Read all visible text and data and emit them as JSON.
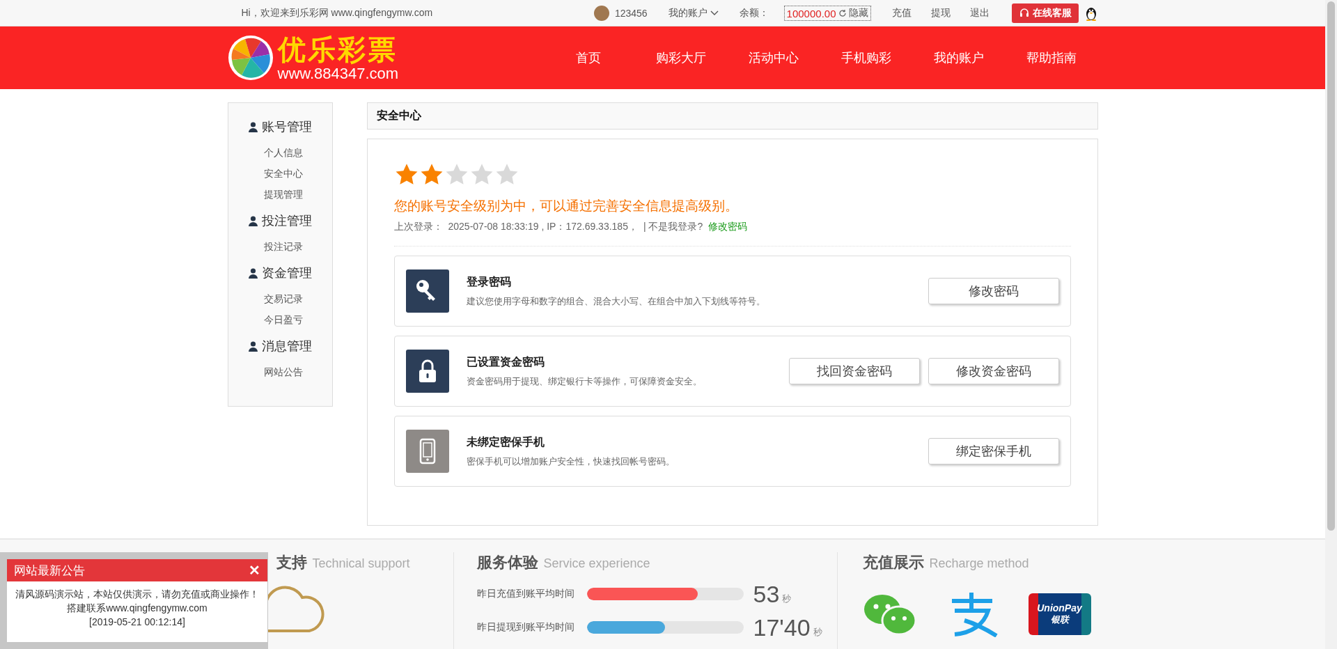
{
  "top_bar": {
    "welcome": "Hi，欢迎来到乐彩网 www.qingfengymw.com",
    "username": "123456",
    "account_menu": "我的账户",
    "balance_label": "余额：",
    "balance": "100000.00",
    "hide_button": "隐藏",
    "links": [
      "充值",
      "提现",
      "退出"
    ],
    "service_button": "在线客服"
  },
  "header": {
    "logo_title": "优乐彩票",
    "logo_url": "www.884347.com",
    "nav": [
      {
        "label": "首页",
        "selected": false
      },
      {
        "label": "购彩大厅",
        "selected": false
      },
      {
        "label": "活动中心",
        "selected": false
      },
      {
        "label": "手机购彩",
        "selected": false
      },
      {
        "label": "我的账户",
        "selected": false
      },
      {
        "label": "帮助指南",
        "selected": false
      }
    ]
  },
  "sidebar": [
    {
      "title": "账号管理",
      "items": [
        {
          "label": "个人信息",
          "selected": false
        },
        {
          "label": "安全中心",
          "selected": false
        },
        {
          "label": "提现管理",
          "selected": false
        }
      ]
    },
    {
      "title": "投注管理",
      "items": [
        {
          "label": "投注记录",
          "selected": false
        }
      ]
    },
    {
      "title": "资金管理",
      "items": [
        {
          "label": "交易记录",
          "selected": false
        },
        {
          "label": "今日盈亏",
          "selected": false
        }
      ]
    },
    {
      "title": "消息管理",
      "items": [
        {
          "label": "网站公告",
          "selected": false
        }
      ]
    }
  ],
  "page_title": "安全中心",
  "security": {
    "stars": 2,
    "message": "您的账号安全级别为中，可以通过完善安全信息提高级别。",
    "last_login_label": "上次登录：",
    "last_login": "2025-07-08 18:33:19 , IP：172.69.33.185，",
    "not_me": "| 不是我登录?",
    "change_link": "修改密码"
  },
  "items": [
    {
      "kind": "key",
      "done": true,
      "title": "登录密码",
      "desc": "建议您使用字母和数字的组合、混合大小写、在组合中加入下划线等符号。",
      "buttons": [
        "修改密码"
      ]
    },
    {
      "kind": "lock",
      "done": true,
      "title": "已设置资金密码",
      "desc": "资金密码用于提现、绑定银行卡等操作，可保障资金安全。",
      "buttons": [
        "找回资金密码",
        "修改资金密码"
      ]
    },
    {
      "kind": "phone",
      "done": false,
      "title": "未绑定密保手机",
      "desc": "密保手机可以增加账户安全性，快速找回帐号密码。",
      "buttons": [
        "绑定密保手机"
      ]
    }
  ],
  "footer": {
    "support": {
      "title": "支持",
      "subtitle": "Technical support"
    },
    "service": {
      "title": "服务体验",
      "subtitle": "Service experience",
      "rows": [
        {
          "label": "昨日充值到账平均时间",
          "level": 0.71,
          "color": "#fa5555",
          "value": "53",
          "unit": "秒"
        },
        {
          "label": "昨日提现到账平均时间",
          "level": 0.5,
          "color": "#4aa8dc",
          "value": "17'40",
          "unit": "秒"
        }
      ]
    },
    "recharge": {
      "title": "充值展示",
      "subtitle": "Recharge method",
      "unionpay_text": "UnionPay",
      "unionpay_cn": "银联"
    }
  },
  "notice": {
    "title": "网站最新公告",
    "close": "✕",
    "body": "清风源码演示站，本站仅供演示，请勿充值或商业操作！搭建联系www.qingfengymw.com",
    "date": "[2019-05-21 00:12:14]"
  }
}
